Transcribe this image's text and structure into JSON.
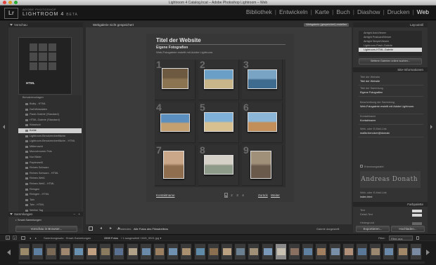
{
  "window": {
    "title": "Lightroom 4 Catalog.lrcat – Adobe Photoshop Lightroom – Web"
  },
  "identity": {
    "badge": "Lr",
    "product_sub": "ADOBE PHOTOSHOP",
    "product": "LIGHTROOM 4",
    "beta": "BETA"
  },
  "modules": [
    "Bibliothek",
    "Entwickeln",
    "Karte",
    "Buch",
    "Diashow",
    "Drucken",
    "Web"
  ],
  "active_module": "Web",
  "left_panel": {
    "preview_header": "Vorschau",
    "preview_label": "HTML",
    "templates": [
      "Bulky - HTML",
      "Daf-Metadaten",
      "Flash-Galerie (Standard)",
      "HTML-Galerie (Standard)",
      "Klassisch",
      "Kohle",
      "Lightroom-Benutzeroberfläche",
      "Lightroom-Benutzeroberfläche - HTML",
      "Mitternacht",
      "Monochromer Fels",
      "Nur Bilder",
      "Papierweiß",
      "Reines Schwarz",
      "Reines Schwarz - HTML",
      "Reines Weiß",
      "Reines Weiß - HTML",
      "Reingen",
      "Reingen - HTML",
      "Tain",
      "Tain - HTML",
      "Weißer Tag"
    ],
    "selected_template": "Kohle",
    "user_templates": "Benutzervorlagen",
    "collections_header": "Sammlungen",
    "collection_item": "Smart-Sammlungen",
    "preview_button": "Vorschau in Browser...",
    "dash": "–",
    "plus": "+"
  },
  "center": {
    "status": "Webgalerie nicht gespeichert",
    "save_button": "Webgalerie (gespeichert) erstellen",
    "site_title": "Titel der Website",
    "collection_title": "Eigene Fotografien",
    "description": "Web-Fotogalerie erstellt mit Adobe Lightroom.",
    "cells": [
      "1",
      "2",
      "3",
      "4",
      "5",
      "6",
      "7",
      "8",
      "9"
    ],
    "contact_link": "Kontaktname",
    "pages": [
      "1",
      "2",
      "3",
      "4"
    ],
    "back": "Zurück",
    "next": "Weiter",
    "toolbar_use_label": "Verwenden:",
    "toolbar_use_value": "Alle Fotos des Filmstreifens",
    "toolbar_right": "Galerie dargestellt"
  },
  "right_panel": {
    "layout_header": "Layoutstil",
    "layouts": [
      "Airtight AutoViewer",
      "Airtight PostcardViewer",
      "Airtight SimpleViewer",
      "Lightroom-Flash-Galerie",
      "Lightroom-HTML-Galerie"
    ],
    "selected_layout": "Lightroom-HTML-Galerie",
    "more_galleries": "Weitere Galerien online suchen...",
    "site_header": "Site-Informationen",
    "fields": [
      {
        "label": "Titel der Website",
        "value": "Titel der Website"
      },
      {
        "label": "Titel der Sammlung",
        "value": "Eigene Fotografien"
      },
      {
        "label": "Beschreibung der Sammlung",
        "value": "Web-Fotogalerie erstellt mit Adobe Lightroom."
      },
      {
        "label": "Kontaktname",
        "value": "Kontaktname"
      },
      {
        "label": "Web- oder E-Mail-Link",
        "value": "mailto:benutzer@domain"
      }
    ],
    "identity_plate_label": "Erkennungstafel",
    "identity_plate": "Andreas Donath",
    "web_link_label": "Web- oder E-Mail-Link",
    "web_link_value": "index.html",
    "color_header": "Farbpalette",
    "colors": [
      {
        "label": "Text",
        "color": "#d8d8d8"
      },
      {
        "label": "Detail-Text",
        "color": "#d8d8d8"
      },
      {
        "label": "Hintergrund",
        "color": "#666666"
      },
      {
        "label": "Detail-Hintergrund",
        "color": "#555555"
      },
      {
        "label": "Zellen",
        "color": "#444444"
      }
    ],
    "export_button": "Exportieren...",
    "upload_button": "Hochladen..."
  },
  "filmstrip_bar": {
    "page1": "1",
    "page2": "2",
    "path": "Sammlungssatz : Smart-Sammlungen",
    "count": "2899 Fotos",
    "selection": "/ 1 ausgewählt / IMG_9021.jpg ▾",
    "filter_label": "Filter:",
    "filter_value": "Filter aus"
  },
  "filmstrip": {
    "selected_index": 19,
    "count": 30
  },
  "colors": {
    "accent": "#f0f0f0",
    "panel": "#333333",
    "background": "#2b2b2b"
  }
}
